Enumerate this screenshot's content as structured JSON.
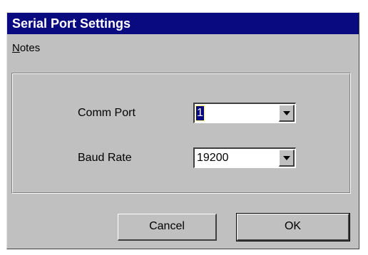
{
  "window": {
    "title": "Serial Port Settings"
  },
  "menu": {
    "items": [
      {
        "accel": "N",
        "rest": "otes"
      }
    ]
  },
  "form": {
    "comm_port": {
      "label": "Comm Port",
      "value": "1"
    },
    "baud_rate": {
      "label": "Baud Rate",
      "value": "19200"
    }
  },
  "buttons": {
    "cancel": "Cancel",
    "ok": "OK"
  },
  "colors": {
    "titlebar": "#0a0a80",
    "face": "#c0c0c0"
  }
}
